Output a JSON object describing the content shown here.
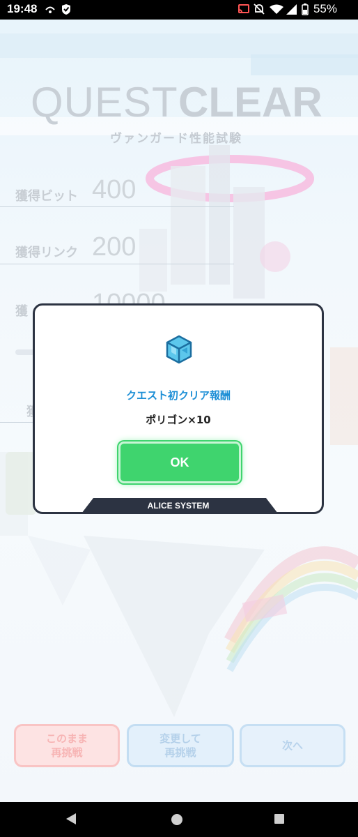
{
  "status_bar": {
    "time": "19:48",
    "battery": "55%"
  },
  "result": {
    "title_word1": "QUEST",
    "title_word2": "CLEAR",
    "quest_name": "ヴァンガード性能試験",
    "stats": [
      {
        "label": "獲得ビット",
        "value": "400"
      },
      {
        "label": "獲得リンク",
        "value": "200"
      },
      {
        "label": "獲",
        "value": "10000"
      }
    ],
    "row4_label": "獲"
  },
  "buttons": {
    "retry_same": "このまま\n再挑戦",
    "retry_change": "変更して\n再挑戦",
    "next": "次へ"
  },
  "modal": {
    "reward_title": "クエスト初クリア報酬",
    "reward_item": "ポリゴン×10",
    "ok_label": "OK",
    "system_label": "ALICE SYSTEM",
    "icon": "polygon-cube-icon"
  },
  "colors": {
    "accent_blue": "#1d8fd6",
    "ok_green": "#3fd46e",
    "frame_dark": "#2c3342"
  }
}
